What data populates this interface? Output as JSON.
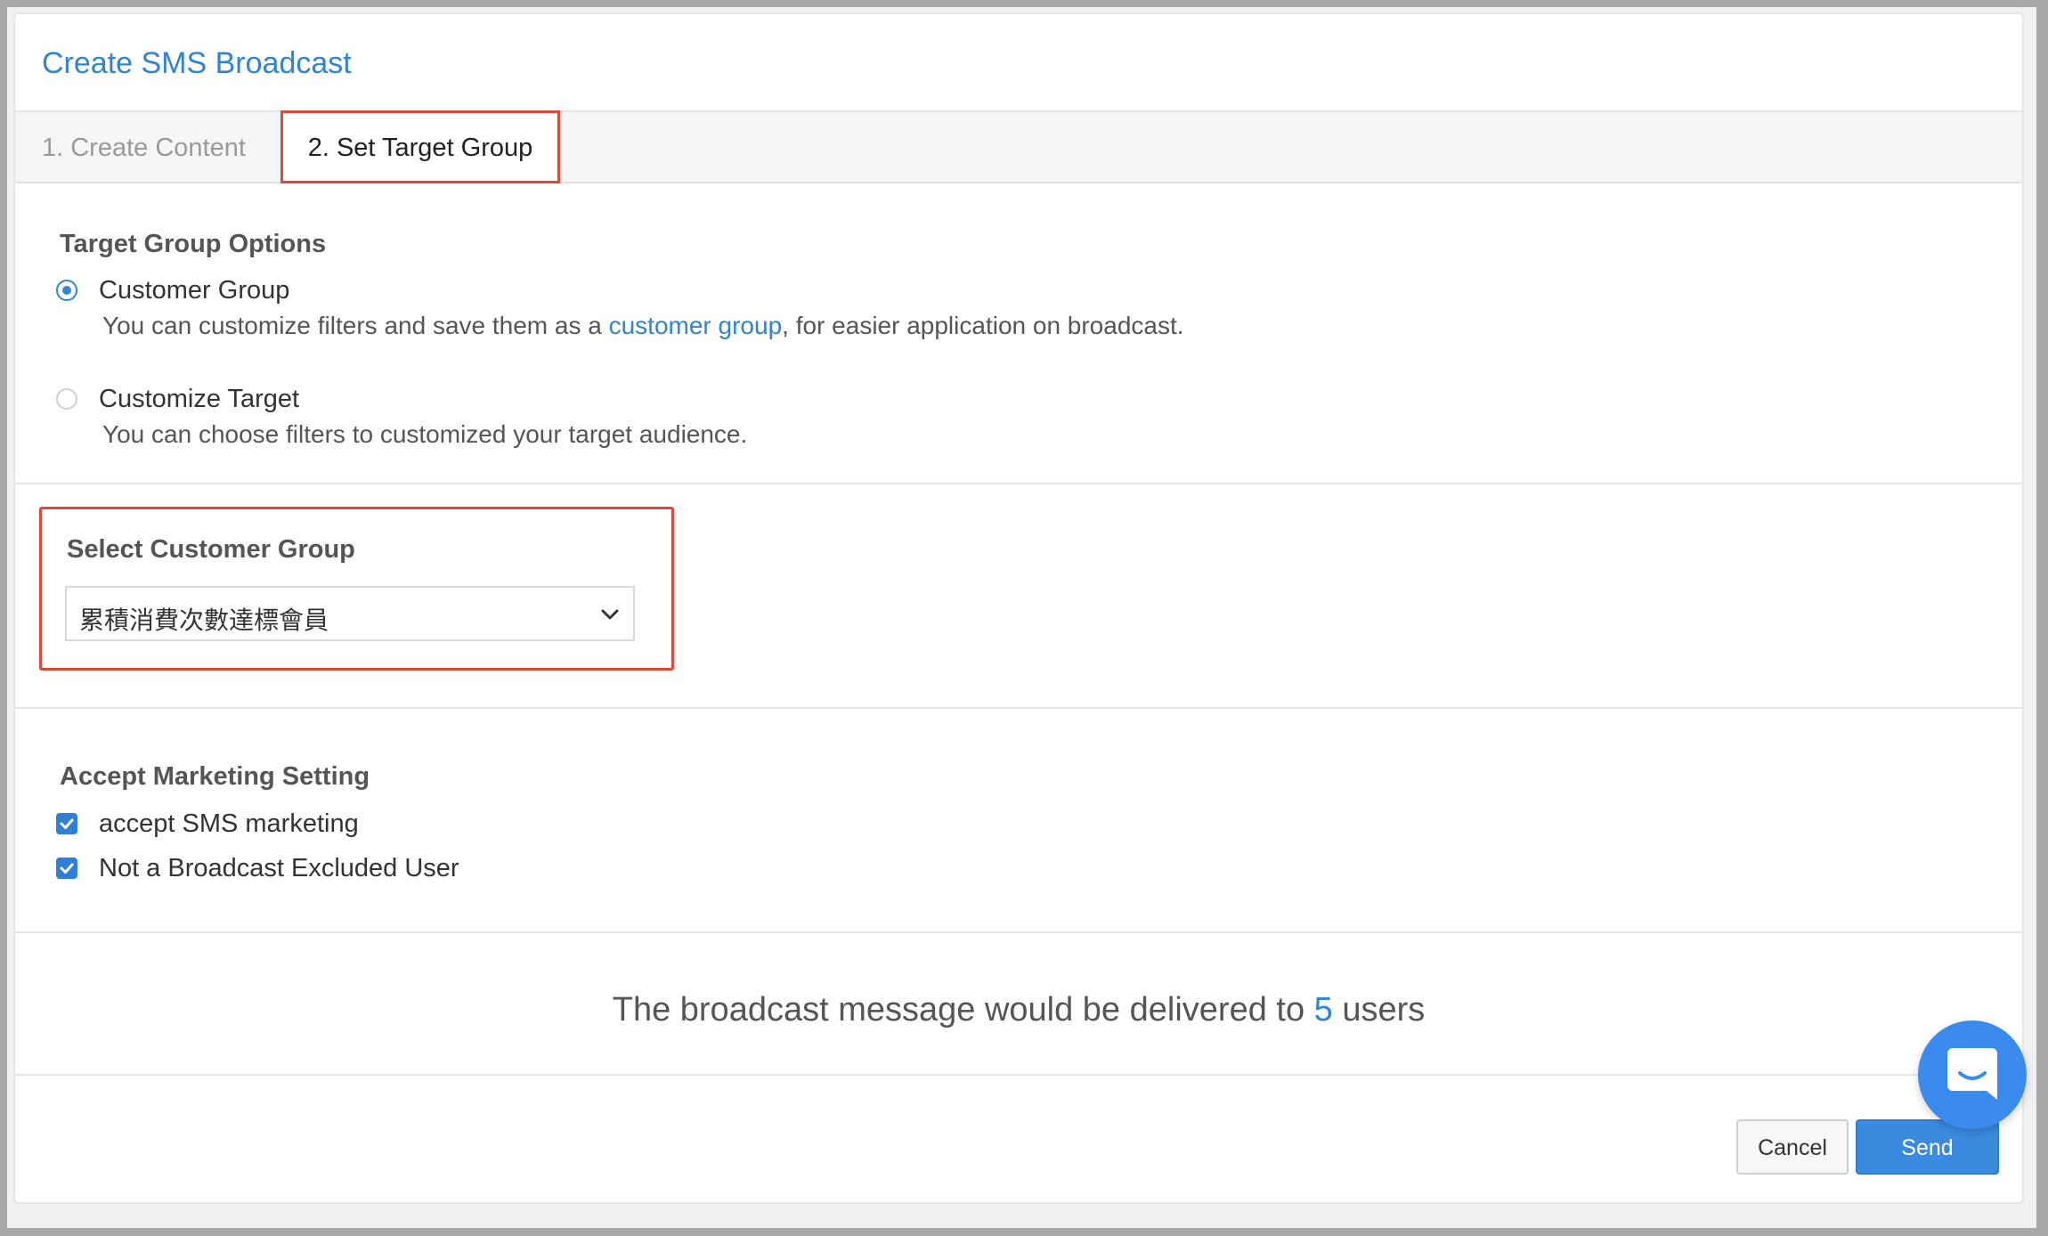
{
  "modal": {
    "title": "Create SMS Broadcast"
  },
  "tabs": [
    {
      "label": "1. Create Content",
      "active": false
    },
    {
      "label": "2. Set Target Group",
      "active": true
    }
  ],
  "target_group_options": {
    "title": "Target Group Options",
    "options": [
      {
        "label": "Customer Group",
        "selected": true,
        "desc_before": "You can customize filters and save them as a ",
        "desc_link": "customer group",
        "desc_after": ", for easier application on broadcast."
      },
      {
        "label": "Customize Target",
        "selected": false,
        "desc": "You can choose filters to customized your target audience."
      }
    ]
  },
  "select_customer_group": {
    "title": "Select Customer Group",
    "selected_value": "累積消費次數達標會員"
  },
  "accept_marketing": {
    "title": "Accept Marketing Setting",
    "checkboxes": [
      {
        "label": "accept SMS marketing",
        "checked": true
      },
      {
        "label": "Not a Broadcast Excluded User",
        "checked": true
      }
    ]
  },
  "delivery": {
    "before": "The broadcast message would be delivered to ",
    "count": "5",
    "after": " users"
  },
  "footer": {
    "cancel_label": "Cancel",
    "send_label": "Send"
  },
  "colors": {
    "accent": "#2f84d6",
    "highlight": "#e14934",
    "send_button": "#3a8be0",
    "chat_fab": "#3b8bee"
  },
  "icons": {
    "dropdown": "chevron-down-icon",
    "checkbox": "checkmark-icon",
    "chat": "chat-bubble-icon"
  }
}
